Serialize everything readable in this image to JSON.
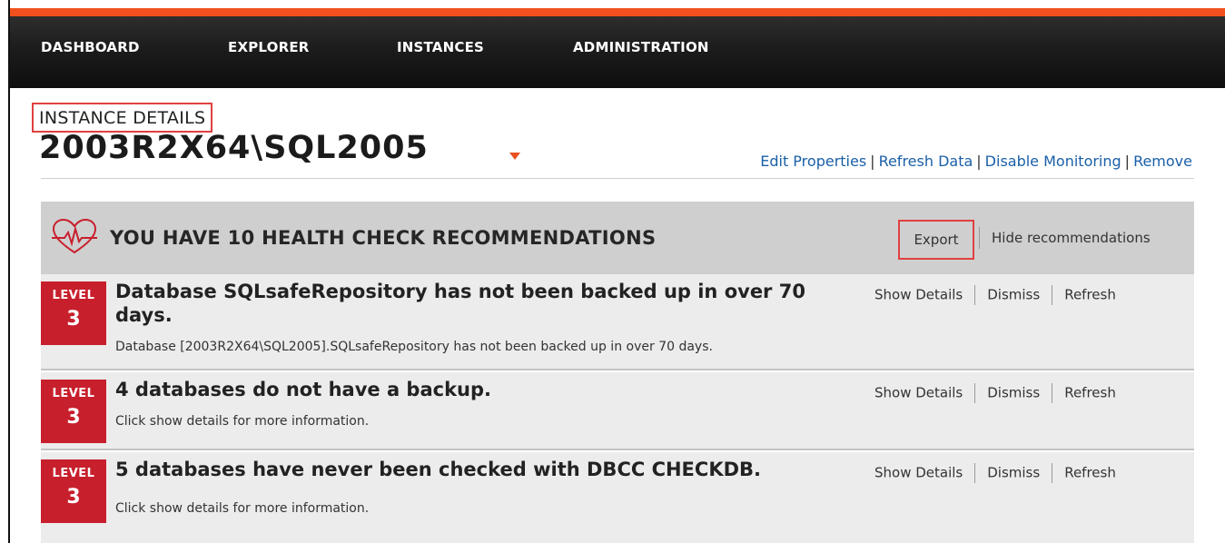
{
  "nav": {
    "items": [
      "DASHBOARD",
      "EXPLORER",
      "INSTANCES",
      "ADMINISTRATION"
    ]
  },
  "instance": {
    "section_label": "INSTANCE DETAILS",
    "name": "2003R2X64\\SQL2005",
    "actions": [
      "Edit Properties",
      "Refresh Data",
      "Disable Monitoring",
      "Remove"
    ]
  },
  "health": {
    "title": "YOU HAVE 10 HEALTH CHECK RECOMMENDATIONS",
    "export_label": "Export",
    "hide_label": "Hide recommendations",
    "icon": "heart-pulse-icon"
  },
  "recommendations": [
    {
      "level_label": "LEVEL",
      "level": "3",
      "title": "Database SQLsafeRepository has not been backed up in over 70 days.",
      "description": "Database [2003R2X64\\SQL2005].SQLsafeRepository has not been backed up in over 70 days.",
      "actions": [
        "Show Details",
        "Dismiss",
        "Refresh"
      ]
    },
    {
      "level_label": "LEVEL",
      "level": "3",
      "title": "4 databases do not have a backup.",
      "description": "Click show details for more information.",
      "actions": [
        "Show Details",
        "Dismiss",
        "Refresh"
      ]
    },
    {
      "level_label": "LEVEL",
      "level": "3",
      "title": "5 databases have never been checked with DBCC CHECKDB.",
      "description": "Click show details for more information.",
      "actions": [
        "Show Details",
        "Dismiss",
        "Refresh"
      ]
    }
  ],
  "colors": {
    "accent": "#f2501e",
    "level_badge": "#c81f2c",
    "link": "#1a5fa8",
    "highlight_box": "#e04040"
  }
}
